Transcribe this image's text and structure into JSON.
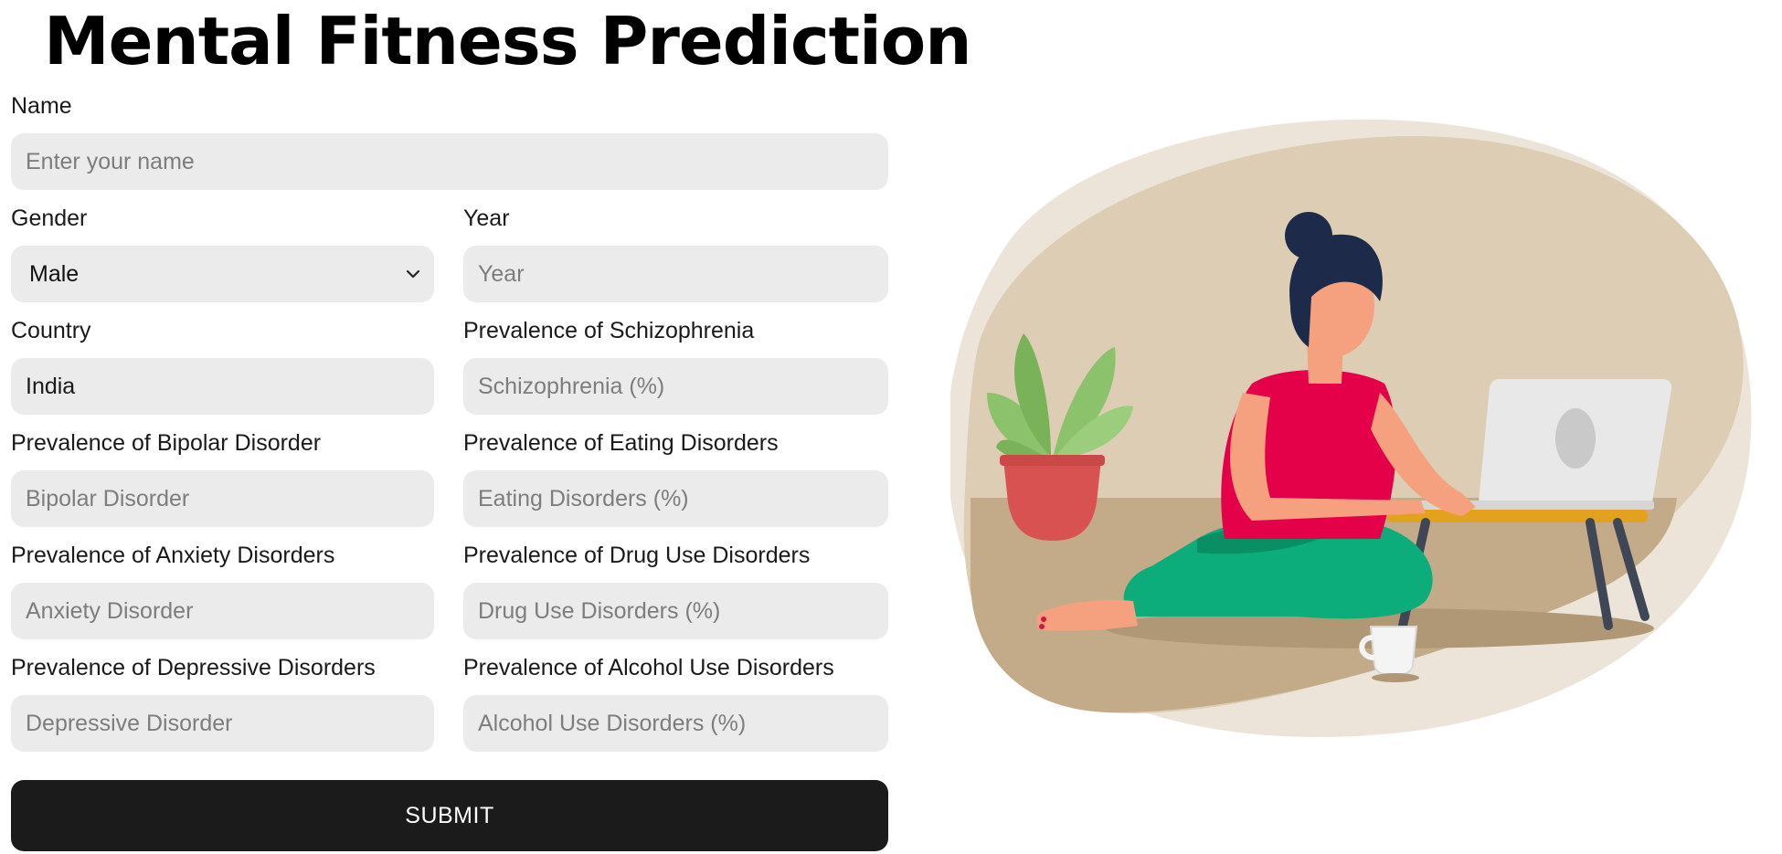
{
  "page": {
    "title": "Mental Fitness Prediction"
  },
  "form": {
    "name": {
      "label": "Name",
      "placeholder": "Enter your name",
      "value": ""
    },
    "gender": {
      "label": "Gender",
      "selected": "Male",
      "options": [
        "Male"
      ]
    },
    "year": {
      "label": "Year",
      "placeholder": "Year",
      "value": ""
    },
    "country": {
      "label": "Country",
      "placeholder": "",
      "value": "India"
    },
    "schizophrenia": {
      "label": "Prevalence of Schizophrenia",
      "placeholder": "Schizophrenia (%)",
      "value": ""
    },
    "bipolar": {
      "label": "Prevalence of Bipolar Disorder",
      "placeholder": "Bipolar Disorder",
      "value": ""
    },
    "eating": {
      "label": "Prevalence of Eating Disorders",
      "placeholder": "Eating Disorders (%)",
      "value": ""
    },
    "anxiety": {
      "label": "Prevalence of Anxiety Disorders",
      "placeholder": "Anxiety Disorder",
      "value": ""
    },
    "drug": {
      "label": "Prevalence of Drug Use Disorders",
      "placeholder": "Drug Use Disorders (%)",
      "value": ""
    },
    "depressive": {
      "label": "Prevalence of Depressive Disorders",
      "placeholder": "Depressive Disorder",
      "value": ""
    },
    "alcohol": {
      "label": "Prevalence of Alcohol Use Disorders",
      "placeholder": "Alcohol Use Disorders (%)",
      "value": ""
    },
    "submit_label": "SUBMIT"
  },
  "illustration": {
    "icon": "woman-with-laptop-illustration",
    "colors": {
      "blob_outer": "#ece4d8",
      "blob_inner": "#dccdb4",
      "floor": "#c3ab89",
      "top": "#e5004a",
      "pants": "#0cad7a",
      "skin": "#f5a17f",
      "hair": "#1e2a4a",
      "pot": "#d85252",
      "leaf": "#8dc26d",
      "table": "#e2a21f",
      "laptop": "#e8e8e8"
    }
  }
}
